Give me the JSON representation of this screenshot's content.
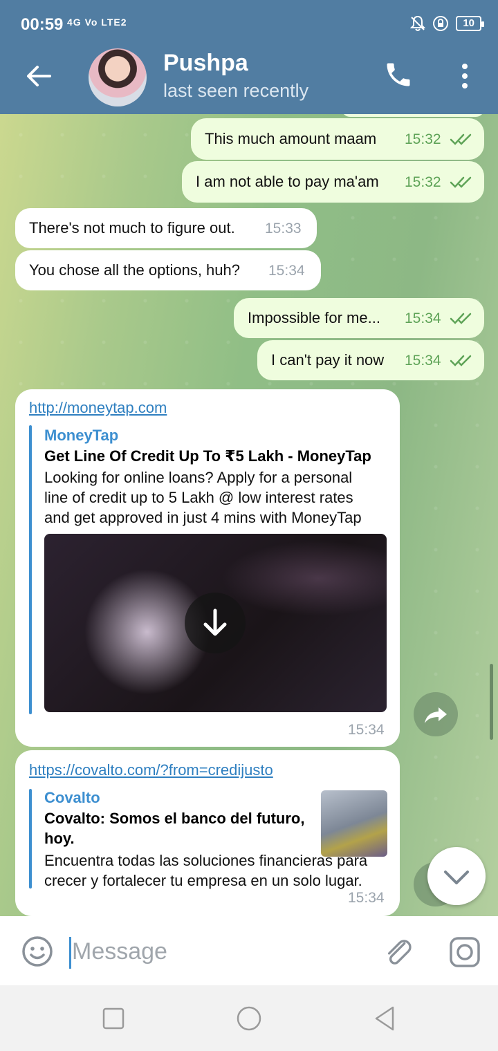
{
  "status_bar": {
    "time": "00:59",
    "network": "4G Vo LTE2",
    "battery": "10"
  },
  "header": {
    "name": "Pushpa",
    "status": "last seen recently"
  },
  "messages": [
    {
      "dir": "out",
      "text": "This much amount maam",
      "time": "15:32",
      "read": true
    },
    {
      "dir": "out",
      "text": "I am not able to pay ma'am",
      "time": "15:32",
      "read": true
    },
    {
      "dir": "in",
      "text": "There's not much to figure out.",
      "time": "15:33"
    },
    {
      "dir": "in",
      "text": "You chose all the options, huh?",
      "time": "15:34"
    },
    {
      "dir": "out",
      "text": "Impossible for me...",
      "time": "15:34",
      "read": true
    },
    {
      "dir": "out",
      "text": "I can't pay it now",
      "time": "15:34",
      "read": true
    }
  ],
  "link_cards": [
    {
      "url": "http://moneytap.com",
      "site": "MoneyTap",
      "title": "Get Line Of Credit Up To ₹5 Lakh - MoneyTap",
      "desc_lines": [
        "Looking for online loans? Apply for a personal",
        "line of credit up to 5 Lakh @ low interest rates",
        "and get approved in just 4 mins with MoneyTap"
      ],
      "time": "15:34"
    },
    {
      "url": "https://covalto.com/?from=credijusto",
      "site": "Covalto",
      "title_lines": [
        "Covalto: Somos el banco del futuro,",
        "hoy."
      ],
      "desc_lines": [
        "Encuentra todas las soluciones financieras para",
        "crecer y fortalecer tu empresa en un solo lugar."
      ],
      "time": "15:34"
    }
  ],
  "input": {
    "placeholder": "Message"
  },
  "icons": [
    "back-arrow-icon",
    "phone-icon",
    "more-vert-icon",
    "download-icon",
    "share-icon",
    "chevron-down-icon",
    "emoji-icon",
    "attach-icon",
    "camera-icon"
  ]
}
